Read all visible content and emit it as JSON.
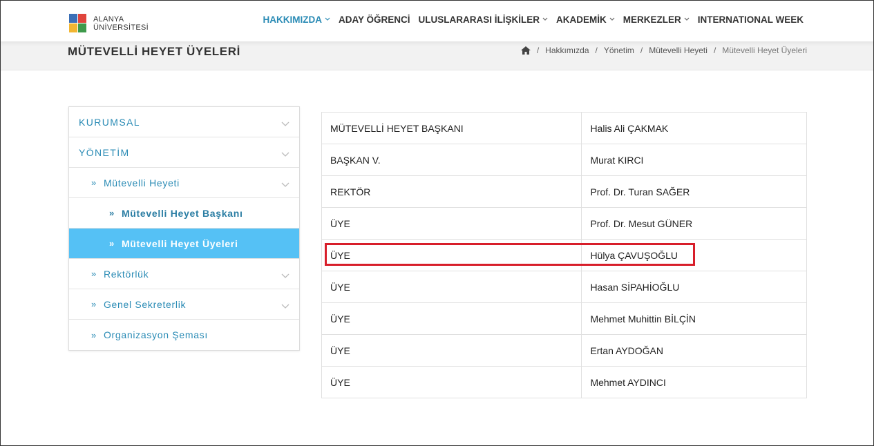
{
  "header": {
    "logo_line1": "ALANYA",
    "logo_line2": "ÜNİVERSİTESİ",
    "nav": [
      {
        "label": "HAKKIMIZDA",
        "has_dropdown": true,
        "active": true
      },
      {
        "label": "ADAY ÖĞRENCİ",
        "has_dropdown": false
      },
      {
        "label": "ULUSLARARASI İLİŞKİLER",
        "has_dropdown": true
      },
      {
        "label": "AKADEMİK",
        "has_dropdown": true
      },
      {
        "label": "MERKEZLER",
        "has_dropdown": true
      },
      {
        "label": "INTERNATIONAL WEEK",
        "has_dropdown": false
      }
    ]
  },
  "title_bar": {
    "title": "MÜTEVELLİ HEYET ÜYELERİ",
    "breadcrumb": [
      "Hakkımızda",
      "Yönetim",
      "Mütevelli Heyeti",
      "Mütevelli Heyet Üyeleri"
    ]
  },
  "sidebar": {
    "items": [
      {
        "label": "KURUMSAL",
        "level": 0,
        "chevron": true
      },
      {
        "label": "YÖNETİM",
        "level": 0,
        "chevron": true
      },
      {
        "label": "Mütevelli Heyeti",
        "level": 1,
        "chevron": true
      },
      {
        "label": "Mütevelli Heyet Başkanı",
        "level": 2,
        "chevron": false
      },
      {
        "label": "Mütevelli Heyet Üyeleri",
        "level": 2,
        "chevron": false,
        "active": true
      },
      {
        "label": "Rektörlük",
        "level": 1,
        "chevron": true
      },
      {
        "label": "Genel Sekreterlik",
        "level": 1,
        "chevron": true
      },
      {
        "label": "Organizasyon Şeması",
        "level": 1,
        "chevron": false
      }
    ]
  },
  "members": {
    "rows": [
      {
        "role": "MÜTEVELLİ HEYET BAŞKANI",
        "name": "Halis Ali ÇAKMAK"
      },
      {
        "role": "BAŞKAN V.",
        "name": "Murat KIRCI"
      },
      {
        "role": "REKTÖR",
        "name": "Prof. Dr. Turan SAĞER"
      },
      {
        "role": "ÜYE",
        "name": "Prof. Dr. Mesut GÜNER"
      },
      {
        "role": "ÜYE",
        "name": "Hülya ÇAVUŞOĞLU",
        "highlighted": true
      },
      {
        "role": "ÜYE",
        "name": "Hasan SİPAHİOĞLU"
      },
      {
        "role": "ÜYE",
        "name": "Mehmet Muhittin BİLÇİN"
      },
      {
        "role": "ÜYE",
        "name": "Ertan AYDOĞAN"
      },
      {
        "role": "ÜYE",
        "name": "Mehmet AYDINCI"
      }
    ]
  },
  "colors": {
    "accent": "#2a8bb5",
    "active_sidebar": "#55c1f5",
    "highlight_border": "#d81e2a"
  }
}
